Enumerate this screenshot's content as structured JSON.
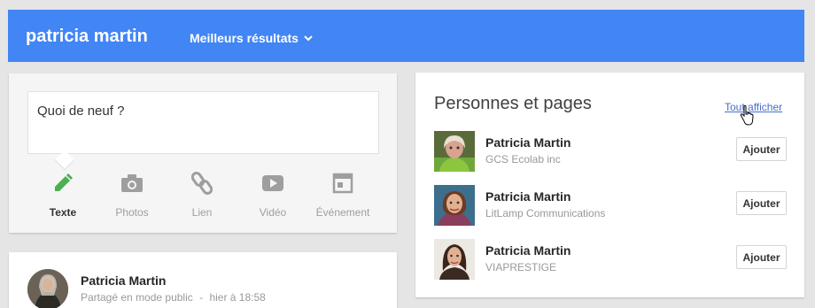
{
  "header": {
    "query": "patricia martin",
    "sort_label": "Meilleurs résultats"
  },
  "share": {
    "prompt": "Quoi de neuf ?",
    "actions": [
      {
        "label": "Texte",
        "icon": "pencil-icon",
        "active": true
      },
      {
        "label": "Photos",
        "icon": "camera-icon",
        "active": false
      },
      {
        "label": "Lien",
        "icon": "link-icon",
        "active": false
      },
      {
        "label": "Vidéo",
        "icon": "video-play-icon",
        "active": false
      },
      {
        "label": "Événement",
        "icon": "calendar-icon",
        "active": false
      }
    ]
  },
  "post": {
    "author": "Patricia Martin",
    "visibility": "Partagé en mode public",
    "separator": "-",
    "time": "hier à 18:58"
  },
  "people": {
    "title": "Personnes et pages",
    "see_all": "Tout afficher",
    "add_label": "Ajouter",
    "items": [
      {
        "name": "Patricia Martin",
        "org": "GCS Ecolab inc"
      },
      {
        "name": "Patricia Martin",
        "org": "LitLamp Communications"
      },
      {
        "name": "Patricia Martin",
        "org": "VIAPRESTIGE"
      }
    ]
  },
  "colors": {
    "header_bg": "#4285f4",
    "accent_green": "#4caf50",
    "link_blue": "#4a70c9"
  }
}
